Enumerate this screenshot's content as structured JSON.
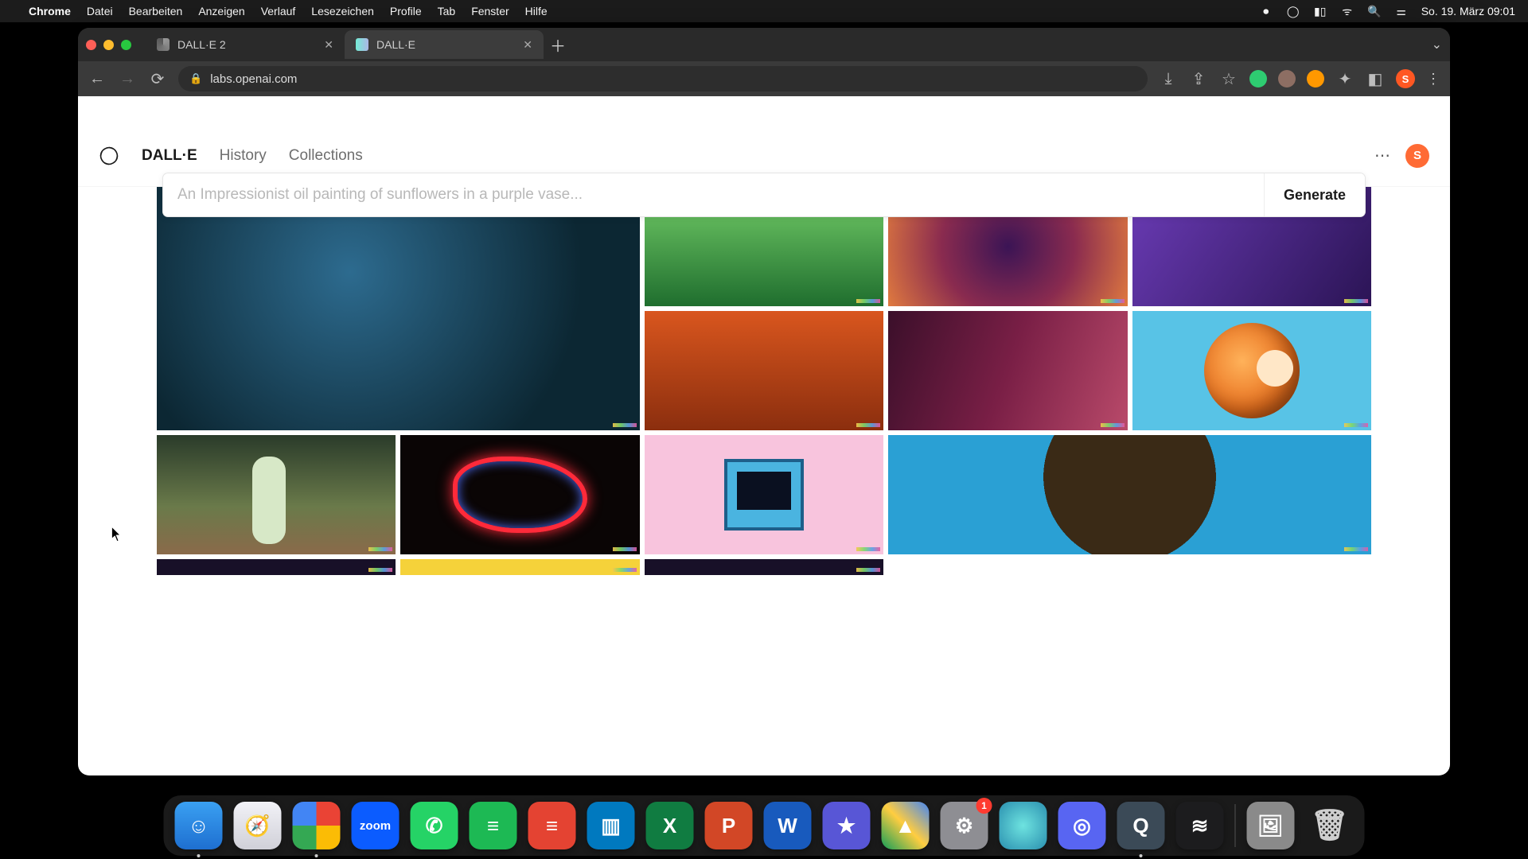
{
  "menubar": {
    "app": "Chrome",
    "items": [
      "Datei",
      "Bearbeiten",
      "Anzeigen",
      "Verlauf",
      "Lesezeichen",
      "Profile",
      "Tab",
      "Fenster",
      "Hilfe"
    ],
    "datetime": "So. 19. März  09:01"
  },
  "tabs": [
    {
      "title": "DALL·E 2",
      "active": false
    },
    {
      "title": "DALL·E",
      "active": true
    }
  ],
  "url": "labs.openai.com",
  "profile_initial": "S",
  "header": {
    "brand": "DALL·E",
    "nav": [
      "History",
      "Collections"
    ],
    "avatar_initial": "S"
  },
  "prompt": {
    "placeholder": "An Impressionist oil painting of sunflowers in a purple vase...",
    "generate_label": "Generate"
  },
  "gallery": [
    {
      "name": "fishbowl-render",
      "size": "big",
      "art": "art-fishbowl"
    },
    {
      "name": "green-abstract",
      "size": "sm",
      "art": "art-green"
    },
    {
      "name": "nebula-painting",
      "size": "sm",
      "art": "art-nebula"
    },
    {
      "name": "purple-figure",
      "size": "sm",
      "art": "art-purple"
    },
    {
      "name": "robot-chess-painting",
      "size": "sm",
      "art": "art-robot"
    },
    {
      "name": "dune-silhouette",
      "size": "sm",
      "art": "art-dune"
    },
    {
      "name": "orange-on-blue",
      "size": "sm",
      "art": "art-orange"
    },
    {
      "name": "astronaut-field",
      "size": "sm",
      "art": "art-astro"
    },
    {
      "name": "neon-face",
      "size": "sm",
      "art": "art-neon"
    },
    {
      "name": "retro-computer",
      "size": "sm",
      "art": "art-pc"
    },
    {
      "name": "athlete-portrait",
      "size": "wide",
      "art": "art-portrait"
    }
  ],
  "dock": {
    "apps": [
      {
        "name": "finder",
        "bg": "linear-gradient(#3aa0f2,#1e6fd0)",
        "glyph": "☺",
        "running": true
      },
      {
        "name": "safari",
        "bg": "linear-gradient(#f2f2f7,#d0d0d8)",
        "glyph": "🧭",
        "running": false
      },
      {
        "name": "chrome",
        "bg": "conic-gradient(#ea4335 0 25%,#fbbc05 0 50%,#34a853 0 75%,#4285f4 0)",
        "glyph": "",
        "running": true
      },
      {
        "name": "zoom",
        "bg": "#0b5cff",
        "glyph": "zoom",
        "running": false,
        "small": true
      },
      {
        "name": "whatsapp",
        "bg": "#25d366",
        "glyph": "✆",
        "running": false
      },
      {
        "name": "spotify",
        "bg": "#1db954",
        "glyph": "≡",
        "running": false
      },
      {
        "name": "todoist",
        "bg": "#e44332",
        "glyph": "≡",
        "running": false
      },
      {
        "name": "trello",
        "bg": "#0079bf",
        "glyph": "▥",
        "running": false
      },
      {
        "name": "excel",
        "bg": "#107c41",
        "glyph": "X",
        "running": false
      },
      {
        "name": "powerpoint",
        "bg": "#d24726",
        "glyph": "P",
        "running": false
      },
      {
        "name": "word",
        "bg": "#185abd",
        "glyph": "W",
        "running": false
      },
      {
        "name": "imovie",
        "bg": "#5856d6",
        "glyph": "★",
        "running": false
      },
      {
        "name": "google-drive",
        "bg": "linear-gradient(45deg,#0f9d58,#ffcd40,#4285f4)",
        "glyph": "▲",
        "running": false
      },
      {
        "name": "settings",
        "bg": "#8e8e93",
        "glyph": "⚙",
        "running": false,
        "badge": "1"
      },
      {
        "name": "siri-orb",
        "bg": "radial-gradient(circle,#6ee3e0,#2a8faf)",
        "glyph": "",
        "running": false
      },
      {
        "name": "discord",
        "bg": "#5865f2",
        "glyph": "◎",
        "running": false
      },
      {
        "name": "quicktime",
        "bg": "#3b4a57",
        "glyph": "Q",
        "running": true
      },
      {
        "name": "voice-memos",
        "bg": "#1c1c1e",
        "glyph": "≋",
        "running": false
      }
    ],
    "right": [
      {
        "name": "preview-stack",
        "bg": "#8a8a8a",
        "glyph": "🖼"
      },
      {
        "name": "trash",
        "bg": "transparent",
        "glyph": "🗑"
      }
    ]
  }
}
